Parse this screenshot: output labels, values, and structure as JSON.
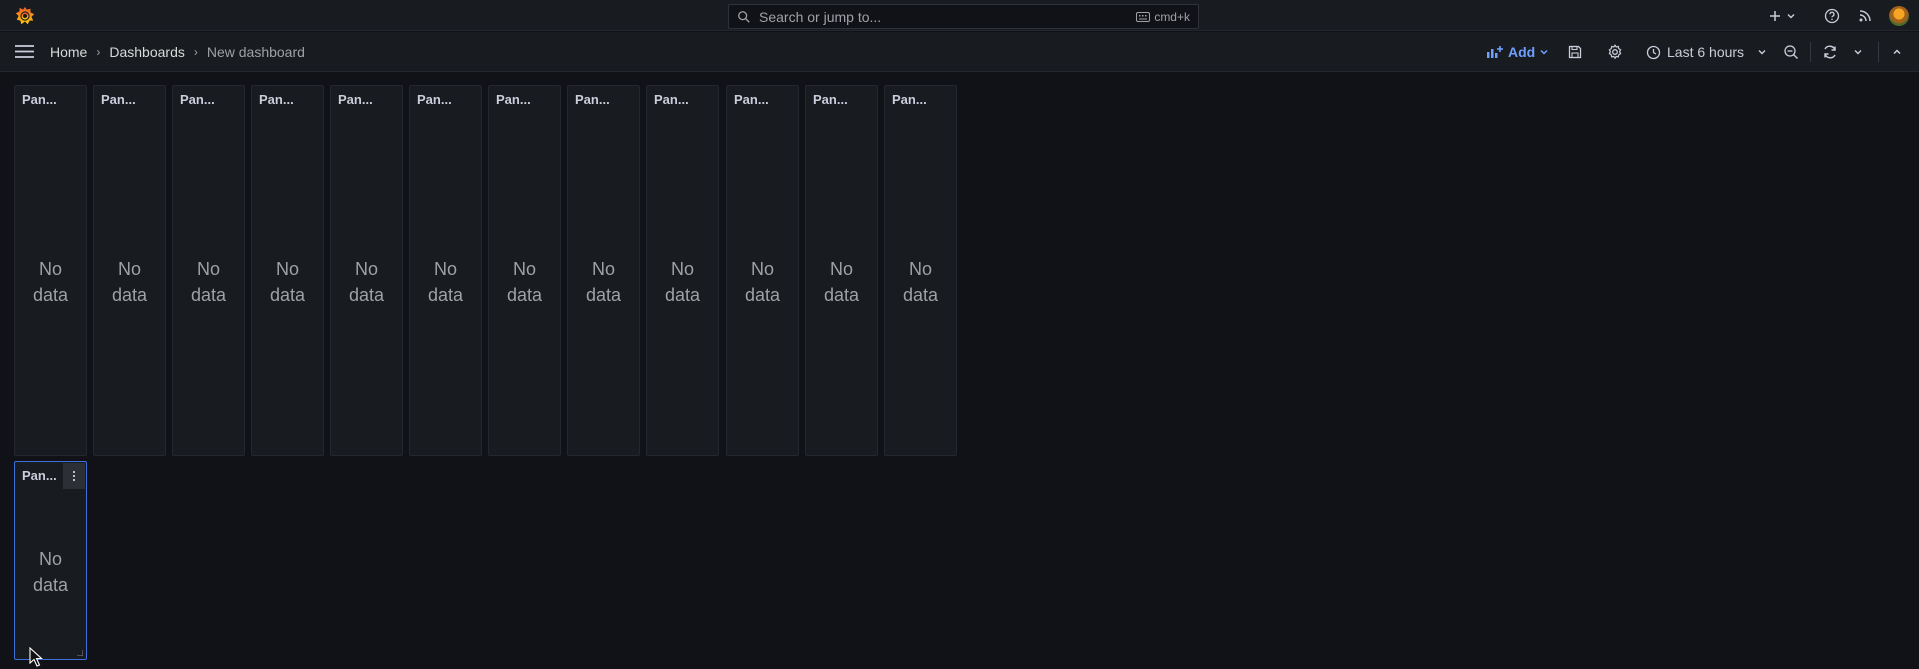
{
  "topbar": {
    "search_placeholder": "Search or jump to...",
    "search_shortcut": "cmd+k",
    "icons": [
      "grafana-logo-icon",
      "plus-icon",
      "chevron-down-icon",
      "help-icon",
      "news-rss-icon",
      "user-avatar"
    ]
  },
  "navbar": {
    "breadcrumbs": [
      "Home",
      "Dashboards",
      "New dashboard"
    ],
    "add_label": "Add",
    "time_range": "Last 6 hours"
  },
  "panels": [
    {
      "title": "Pan...",
      "message_line1": "No",
      "message_line2": "data"
    },
    {
      "title": "Pan...",
      "message_line1": "No",
      "message_line2": "data"
    },
    {
      "title": "Pan...",
      "message_line1": "No",
      "message_line2": "data"
    },
    {
      "title": "Pan...",
      "message_line1": "No",
      "message_line2": "data"
    },
    {
      "title": "Pan...",
      "message_line1": "No",
      "message_line2": "data"
    },
    {
      "title": "Pan...",
      "message_line1": "No",
      "message_line2": "data"
    },
    {
      "title": "Pan...",
      "message_line1": "No",
      "message_line2": "data"
    },
    {
      "title": "Pan...",
      "message_line1": "No",
      "message_line2": "data"
    },
    {
      "title": "Pan...",
      "message_line1": "No",
      "message_line2": "data"
    },
    {
      "title": "Pan...",
      "message_line1": "No",
      "message_line2": "data"
    },
    {
      "title": "Pan...",
      "message_line1": "No",
      "message_line2": "data"
    },
    {
      "title": "Pan...",
      "message_line1": "No",
      "message_line2": "data"
    },
    {
      "title": "Pan...",
      "message_line1": "No",
      "message_line2": "data"
    }
  ],
  "colors": {
    "background": "#111217",
    "panel": "#181b1f",
    "accent_blue": "#6e9fff",
    "selected_border": "#3d71d9",
    "logo_orange": "#f46800"
  }
}
